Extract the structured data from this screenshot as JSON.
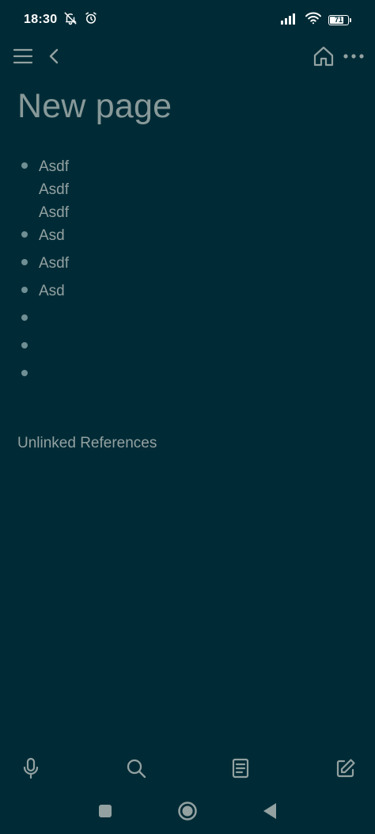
{
  "status_bar": {
    "time": "18:30",
    "battery_level": "71",
    "icons": [
      "mute-icon",
      "alarm-icon",
      "signal-icon",
      "wifi-icon",
      "battery-icon"
    ]
  },
  "header": {
    "icons": [
      "menu-icon",
      "back-icon",
      "home-icon",
      "more-icon"
    ]
  },
  "page": {
    "title": "New page",
    "blocks": [
      {
        "lines": [
          "Asdf",
          "Asdf",
          "Asdf"
        ]
      },
      {
        "lines": [
          "Asd"
        ]
      },
      {
        "lines": [
          "Asdf"
        ]
      },
      {
        "lines": [
          "Asd"
        ]
      },
      {
        "lines": [
          ""
        ]
      },
      {
        "lines": [
          ""
        ]
      },
      {
        "lines": [
          ""
        ]
      }
    ],
    "unlinked_references": "Unlinked References"
  },
  "toolbar": {
    "icons": [
      "microphone-icon",
      "search-icon",
      "document-icon",
      "edit-icon"
    ]
  },
  "nav_bar": {
    "icons": [
      "recents-icon",
      "home-circle-icon",
      "nav-back-icon"
    ]
  },
  "colors": {
    "background": "#002b36",
    "text": "#93a1a1",
    "title": "#889999",
    "bullet": "#6f8f94",
    "status_text": "#ffffff"
  }
}
